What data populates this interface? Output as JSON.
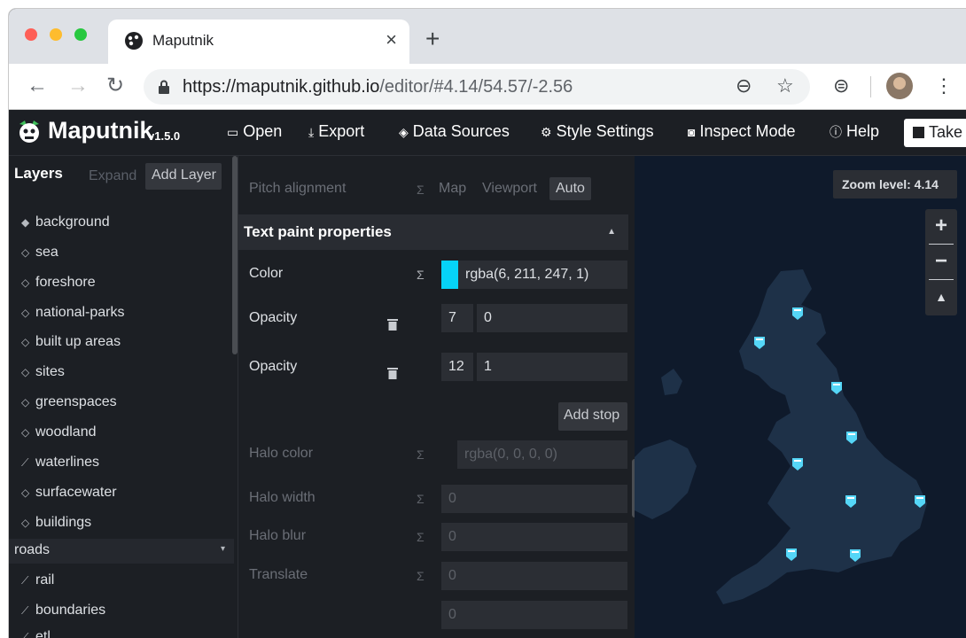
{
  "browser": {
    "tab_title": "Maputnik",
    "tab_close": "×",
    "new_tab": "+",
    "url_host": "https://maputnik.github.io",
    "url_path": "/editor/#4.14/54.57/-2.56",
    "nav": {
      "back": "←",
      "forward": "→",
      "reload": "↻"
    },
    "icons": {
      "zoom": "⊖",
      "star": "☆",
      "sync": "⊜",
      "menu": "⋮"
    }
  },
  "app": {
    "name": "Maputnik",
    "version": "v1.5.0",
    "menu": [
      {
        "icon": "▭",
        "label": "Open"
      },
      {
        "icon": "⤓",
        "label": "Export"
      },
      {
        "icon": "◈",
        "label": "Data Sources"
      },
      {
        "icon": "⚙",
        "label": "Style Settings"
      },
      {
        "icon": "◙",
        "label": "Inspect Mode"
      },
      {
        "icon": "ⓘ",
        "label": "Help"
      }
    ],
    "take_label": "Take"
  },
  "layers": {
    "title": "Layers",
    "expand_label": "Expand",
    "add_label": "Add Layer",
    "items": [
      {
        "icon": "◆",
        "label": "background"
      },
      {
        "icon": "◇",
        "label": "sea"
      },
      {
        "icon": "◇",
        "label": "foreshore"
      },
      {
        "icon": "◇",
        "label": "national-parks"
      },
      {
        "icon": "◇",
        "label": "built up areas"
      },
      {
        "icon": "◇",
        "label": "sites"
      },
      {
        "icon": "◇",
        "label": "greenspaces"
      },
      {
        "icon": "◇",
        "label": "woodland"
      },
      {
        "icon": "⟋",
        "label": "waterlines"
      },
      {
        "icon": "◇",
        "label": "surfacewater"
      },
      {
        "icon": "◇",
        "label": "buildings"
      }
    ],
    "group": {
      "label": "roads",
      "caret": "▾"
    },
    "group_items": [
      {
        "icon": "⟋",
        "label": "rail"
      },
      {
        "icon": "⟋",
        "label": "boundaries"
      },
      {
        "icon": "⟋",
        "label": "etl"
      }
    ]
  },
  "editor": {
    "pitch_alignment": {
      "label": "Pitch alignment",
      "sigma": "Σ",
      "options": [
        "Map",
        "Viewport",
        "Auto"
      ],
      "selected": "Auto"
    },
    "section": {
      "title": "Text paint properties",
      "caret": "▲"
    },
    "color": {
      "label": "Color",
      "sigma": "Σ",
      "value": "rgba(6, 211, 247, 1)",
      "swatch": "#06d3f7"
    },
    "opacity_stops": [
      {
        "label": "Opacity",
        "zoom": "7",
        "value": "0"
      },
      {
        "label": "Opacity",
        "zoom": "12",
        "value": "1"
      }
    ],
    "add_stop": "Add stop",
    "halo_color": {
      "label": "Halo color",
      "sigma": "Σ",
      "value": "rgba(0, 0, 0, 0)"
    },
    "halo_width": {
      "label": "Halo width",
      "sigma": "Σ",
      "value": "0"
    },
    "halo_blur": {
      "label": "Halo blur",
      "sigma": "Σ",
      "value": "0"
    },
    "translate": {
      "label": "Translate",
      "sigma": "Σ",
      "value_x": "0",
      "value_y": "0"
    }
  },
  "map": {
    "zoom_label": "Zoom level: 4.14",
    "zoom_in": "+",
    "zoom_out": "−",
    "compass": "▲",
    "marker_color": "#55d6f7",
    "land_color": "#1e3148",
    "sea_color": "#0f1a2b"
  }
}
